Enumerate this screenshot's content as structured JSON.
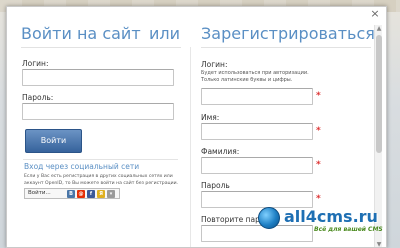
{
  "modal": {
    "close_label": "×",
    "title_login": "Войти на сайт",
    "title_or": "или",
    "title_register": "Зарегистрироваться"
  },
  "login": {
    "login_label": "Логин:",
    "password_label": "Пароль:",
    "login_value": "",
    "password_value": "",
    "submit_label": "Войти"
  },
  "social": {
    "title": "Вход через социальный сети",
    "text": "Если у Вас есть регистрация в других социальных сетях или аккаунт OpenID, то Вы можете войти на сайт без регистрации.",
    "bar_label": "Войти..."
  },
  "register": {
    "login_label": "Логин:",
    "login_hint_1": "Будет использоваться при авторизации.",
    "login_hint_2": "Только латинские буквы и цифры.",
    "name_label": "Имя:",
    "surname_label": "Фамилия:",
    "password_label": "Пароль",
    "password_repeat_label": "Повторите пароль",
    "required_mark": "*"
  },
  "brand": {
    "name": "all4cms.ru",
    "tagline": "Всё для вашей CMS"
  }
}
